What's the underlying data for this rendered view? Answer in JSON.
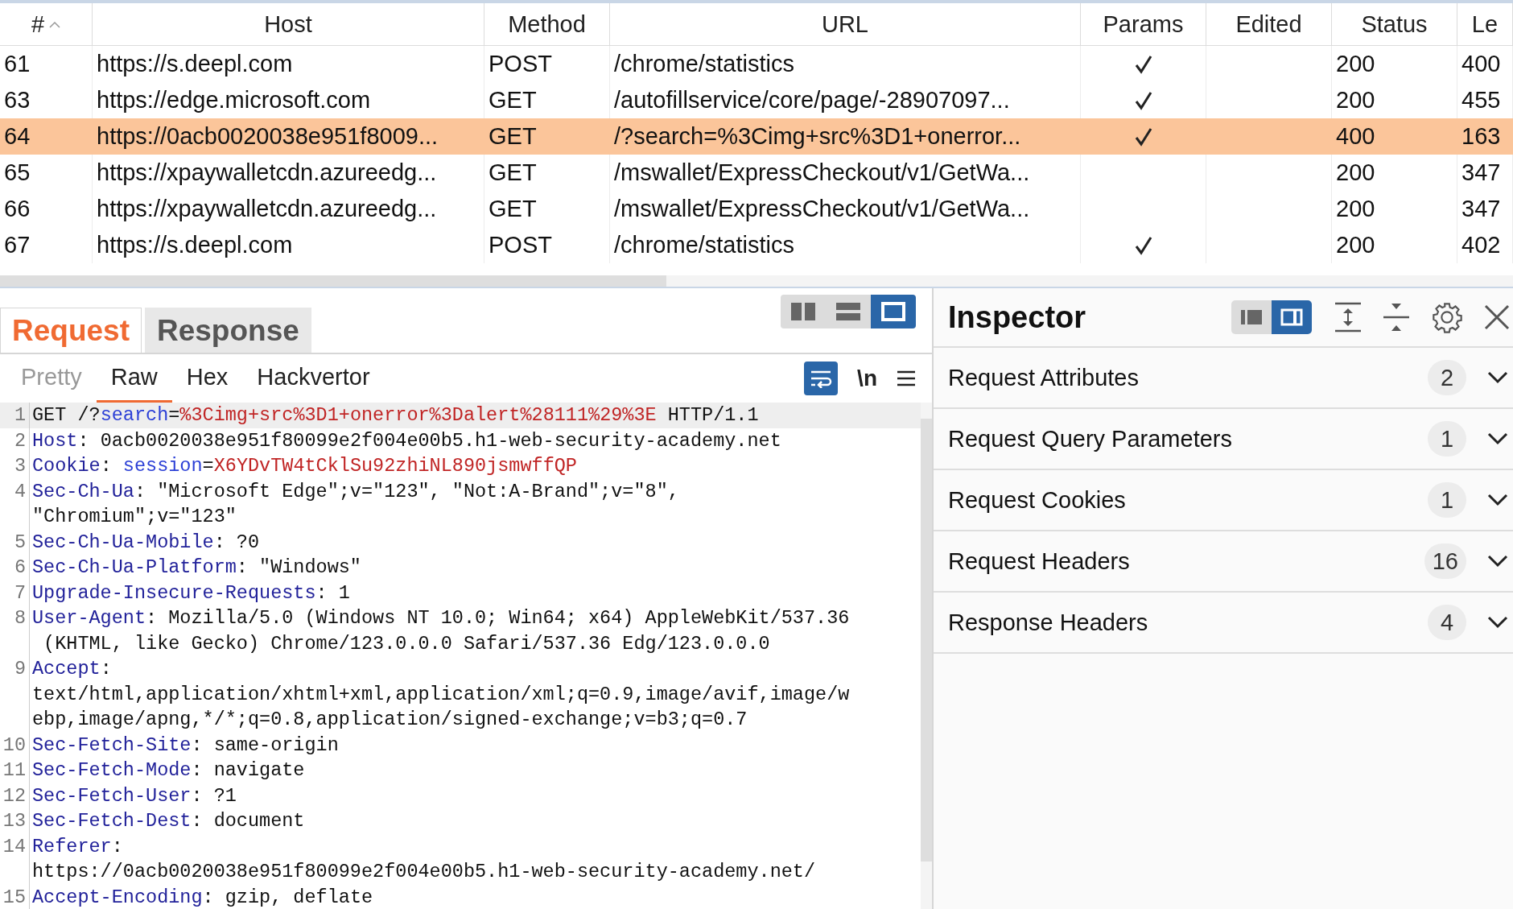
{
  "table": {
    "columns": [
      {
        "label": "#",
        "sorted": true
      },
      {
        "label": "Host",
        "sorted": false
      },
      {
        "label": "Method",
        "sorted": false
      },
      {
        "label": "URL",
        "sorted": false
      },
      {
        "label": "Params",
        "sorted": false
      },
      {
        "label": "Edited",
        "sorted": false
      },
      {
        "label": "Status",
        "sorted": false
      },
      {
        "label": "Le",
        "sorted": false
      }
    ],
    "rows": [
      {
        "num": "61",
        "host": "https://s.deepl.com",
        "method": "POST",
        "url": "/chrome/statistics",
        "params": true,
        "status": "200",
        "length": "400",
        "selected": false
      },
      {
        "num": "63",
        "host": "https://edge.microsoft.com",
        "method": "GET",
        "url": "/autofillservice/core/page/-28907097...",
        "params": true,
        "status": "200",
        "length": "455",
        "selected": false
      },
      {
        "num": "64",
        "host": "https://0acb0020038e951f8009...",
        "method": "GET",
        "url": "/?search=%3Cimg+src%3D1+onerror...",
        "params": true,
        "status": "400",
        "length": "163",
        "selected": true
      },
      {
        "num": "65",
        "host": "https://xpaywalletcdn.azureedg...",
        "method": "GET",
        "url": "/mswallet/ExpressCheckout/v1/GetWa...",
        "params": false,
        "status": "200",
        "length": "347",
        "selected": false
      },
      {
        "num": "66",
        "host": "https://xpaywalletcdn.azureedg...",
        "method": "GET",
        "url": "/mswallet/ExpressCheckout/v1/GetWa...",
        "params": false,
        "status": "200",
        "length": "347",
        "selected": false
      },
      {
        "num": "67",
        "host": "https://s.deepl.com",
        "method": "POST",
        "url": "/chrome/statistics",
        "params": true,
        "status": "200",
        "length": "402",
        "selected": false
      }
    ]
  },
  "editor": {
    "tabs": [
      {
        "label": "Request",
        "selected": true
      },
      {
        "label": "Response",
        "selected": false
      }
    ],
    "layout_buttons": [
      {
        "kind": "columns",
        "selected": false
      },
      {
        "kind": "rows",
        "selected": false
      },
      {
        "kind": "single",
        "selected": true
      }
    ],
    "view_tabs": [
      {
        "label": "Pretty",
        "selected": false,
        "disabled": true
      },
      {
        "label": "Raw",
        "selected": true,
        "disabled": false
      },
      {
        "label": "Hex",
        "selected": false,
        "disabled": false
      },
      {
        "label": "Hackvertor",
        "selected": false,
        "disabled": false
      }
    ],
    "wrap_on": true,
    "newline_button": "\\n",
    "lines": [
      {
        "num": "1",
        "highlighted": true,
        "rows": [
          [
            {
              "text": "GET /?",
              "kind": "plain"
            },
            {
              "text": "search",
              "kind": "param"
            },
            {
              "text": "=",
              "kind": "plain"
            },
            {
              "text": "%3Cimg+src%3D1+onerror%3Dalert%28111%29%3E",
              "kind": "value"
            },
            {
              "text": " HTTP/1.1",
              "kind": "plain"
            }
          ]
        ]
      },
      {
        "num": "2",
        "highlighted": false,
        "rows": [
          [
            {
              "text": "Host",
              "kind": "header"
            },
            {
              "text": ": 0acb0020038e951f80099e2f004e00b5.h1-web-security-academy.net",
              "kind": "plain"
            }
          ]
        ]
      },
      {
        "num": "3",
        "highlighted": false,
        "rows": [
          [
            {
              "text": "Cookie",
              "kind": "header"
            },
            {
              "text": ": ",
              "kind": "plain"
            },
            {
              "text": "session",
              "kind": "param"
            },
            {
              "text": "=",
              "kind": "plain"
            },
            {
              "text": "X6YDvTW4tCklSu92zhiNL890jsmwffQP",
              "kind": "value"
            }
          ]
        ]
      },
      {
        "num": "4",
        "highlighted": false,
        "rows": [
          [
            {
              "text": "Sec-Ch-Ua",
              "kind": "header"
            },
            {
              "text": ": \"Microsoft Edge\";v=\"123\", \"Not:A-Brand\";v=\"8\",",
              "kind": "plain"
            }
          ],
          [
            {
              "text": "\"Chromium\";v=\"123\"",
              "kind": "plain"
            }
          ]
        ]
      },
      {
        "num": "5",
        "highlighted": false,
        "rows": [
          [
            {
              "text": "Sec-Ch-Ua-Mobile",
              "kind": "header"
            },
            {
              "text": ": ?0",
              "kind": "plain"
            }
          ]
        ]
      },
      {
        "num": "6",
        "highlighted": false,
        "rows": [
          [
            {
              "text": "Sec-Ch-Ua-Platform",
              "kind": "header"
            },
            {
              "text": ": \"Windows\"",
              "kind": "plain"
            }
          ]
        ]
      },
      {
        "num": "7",
        "highlighted": false,
        "rows": [
          [
            {
              "text": "Upgrade-Insecure-Requests",
              "kind": "header"
            },
            {
              "text": ": 1",
              "kind": "plain"
            }
          ]
        ]
      },
      {
        "num": "8",
        "highlighted": false,
        "rows": [
          [
            {
              "text": "User-Agent",
              "kind": "header"
            },
            {
              "text": ": Mozilla/5.0 (Windows NT 10.0; Win64; x64) AppleWebKit/537.36",
              "kind": "plain"
            }
          ],
          [
            {
              "text": " (KHTML, like Gecko) Chrome/123.0.0.0 Safari/537.36 Edg/123.0.0.0",
              "kind": "plain"
            }
          ]
        ]
      },
      {
        "num": "9",
        "highlighted": false,
        "rows": [
          [
            {
              "text": "Accept",
              "kind": "header"
            },
            {
              "text": ":",
              "kind": "plain"
            }
          ],
          [
            {
              "text": "text/html,application/xhtml+xml,application/xml;q=0.9,image/avif,image/w",
              "kind": "plain"
            }
          ],
          [
            {
              "text": "ebp,image/apng,*/*;q=0.8,application/signed-exchange;v=b3;q=0.7",
              "kind": "plain"
            }
          ]
        ]
      },
      {
        "num": "10",
        "highlighted": false,
        "rows": [
          [
            {
              "text": "Sec-Fetch-Site",
              "kind": "header"
            },
            {
              "text": ": same-origin",
              "kind": "plain"
            }
          ]
        ]
      },
      {
        "num": "11",
        "highlighted": false,
        "rows": [
          [
            {
              "text": "Sec-Fetch-Mode",
              "kind": "header"
            },
            {
              "text": ": navigate",
              "kind": "plain"
            }
          ]
        ]
      },
      {
        "num": "12",
        "highlighted": false,
        "rows": [
          [
            {
              "text": "Sec-Fetch-User",
              "kind": "header"
            },
            {
              "text": ": ?1",
              "kind": "plain"
            }
          ]
        ]
      },
      {
        "num": "13",
        "highlighted": false,
        "rows": [
          [
            {
              "text": "Sec-Fetch-Dest",
              "kind": "header"
            },
            {
              "text": ": document",
              "kind": "plain"
            }
          ]
        ]
      },
      {
        "num": "14",
        "highlighted": false,
        "rows": [
          [
            {
              "text": "Referer",
              "kind": "header"
            },
            {
              "text": ":",
              "kind": "plain"
            }
          ],
          [
            {
              "text": "https://0acb0020038e951f80099e2f004e00b5.h1-web-security-academy.net/",
              "kind": "plain"
            }
          ]
        ]
      },
      {
        "num": "15",
        "highlighted": false,
        "rows": [
          [
            {
              "text": "Accept-Encoding",
              "kind": "header"
            },
            {
              "text": ": gzip, deflate",
              "kind": "plain"
            }
          ]
        ]
      }
    ]
  },
  "inspector": {
    "title": "Inspector",
    "view_buttons": [
      {
        "kind": "below",
        "selected": false
      },
      {
        "kind": "side",
        "selected": true
      }
    ],
    "sections": [
      {
        "label": "Request Attributes",
        "count": "2",
        "expanded": false
      },
      {
        "label": "Request Query Parameters",
        "count": "1",
        "expanded": false
      },
      {
        "label": "Request Cookies",
        "count": "1",
        "expanded": false
      },
      {
        "label": "Request Headers",
        "count": "16",
        "expanded": false
      },
      {
        "label": "Response Headers",
        "count": "4",
        "expanded": false
      }
    ]
  }
}
